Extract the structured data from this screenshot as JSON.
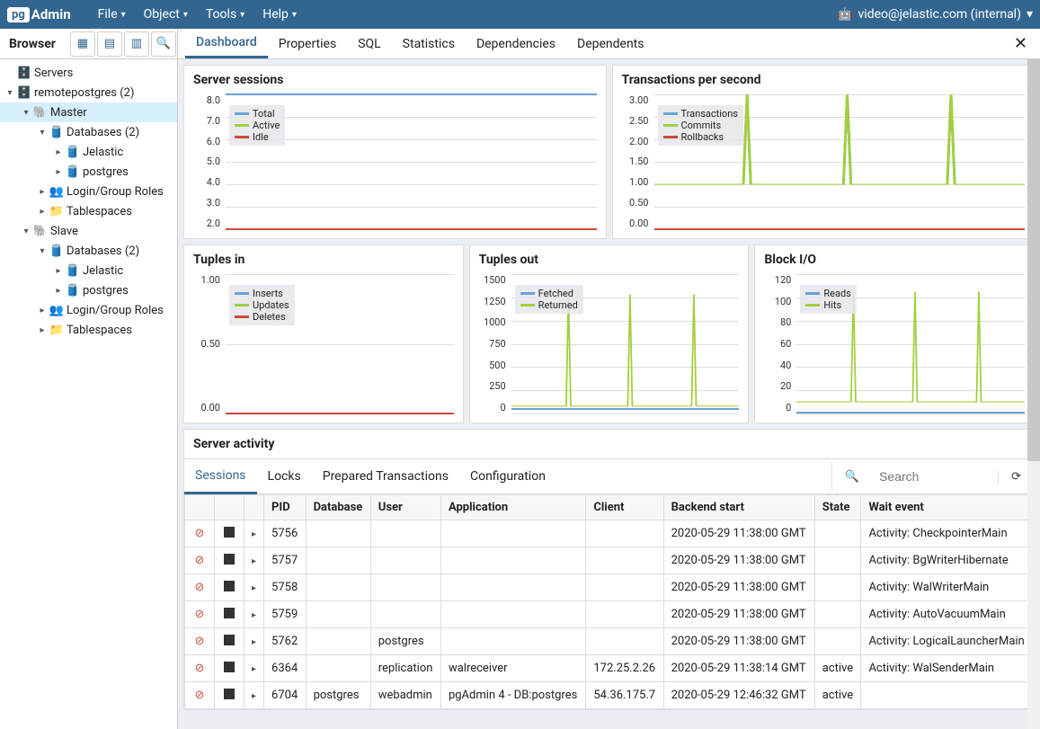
{
  "app": {
    "name_prefix": "pg",
    "name_suffix": "Admin"
  },
  "menu": {
    "file": "File",
    "object": "Object",
    "tools": "Tools",
    "help": "Help"
  },
  "user": {
    "email": "video@jelastic.com (internal)"
  },
  "browser": {
    "label": "Browser"
  },
  "tree": {
    "servers": "Servers",
    "remote": "remotepostgres (2)",
    "master": "Master",
    "databases": "Databases (2)",
    "jelastic": "Jelastic",
    "postgres": "postgres",
    "login_roles": "Login/Group Roles",
    "tablespaces": "Tablespaces",
    "slave": "Slave"
  },
  "tabs": {
    "dashboard": "Dashboard",
    "properties": "Properties",
    "sql": "SQL",
    "statistics": "Statistics",
    "dependencies": "Dependencies",
    "dependents": "Dependents"
  },
  "charts": {
    "sessions": {
      "title": "Server sessions",
      "legend": {
        "total": "Total",
        "active": "Active",
        "idle": "Idle"
      },
      "ylabels": [
        "8.0",
        "7.0",
        "6.0",
        "5.0",
        "4.0",
        "3.0",
        "2.0"
      ]
    },
    "tps": {
      "title": "Transactions per second",
      "legend": {
        "transactions": "Transactions",
        "commits": "Commits",
        "rollbacks": "Rollbacks"
      },
      "ylabels": [
        "3.00",
        "2.50",
        "2.00",
        "1.50",
        "1.00",
        "0.50",
        "0.00"
      ]
    },
    "tuples_in": {
      "title": "Tuples in",
      "legend": {
        "inserts": "Inserts",
        "updates": "Updates",
        "deletes": "Deletes"
      },
      "ylabels": [
        "1.00",
        "0.50",
        "0.00"
      ]
    },
    "tuples_out": {
      "title": "Tuples out",
      "legend": {
        "fetched": "Fetched",
        "returned": "Returned"
      },
      "ylabels": [
        "1500",
        "1250",
        "1000",
        "750",
        "500",
        "250",
        "0"
      ]
    },
    "block_io": {
      "title": "Block I/O",
      "legend": {
        "reads": "Reads",
        "hits": "Hits"
      },
      "ylabels": [
        "120",
        "100",
        "80",
        "60",
        "40",
        "20",
        "0"
      ]
    }
  },
  "chart_data": [
    {
      "id": "sessions",
      "type": "line",
      "title": "Server sessions",
      "series": [
        {
          "name": "Total",
          "color": "#6aa1d8",
          "trend": "flat",
          "value": 8.0
        },
        {
          "name": "Active",
          "color": "#a3cf3d",
          "trend": "flat",
          "value": 2.0
        },
        {
          "name": "Idle",
          "color": "#c94a3b",
          "trend": "flat",
          "value": 2.0
        }
      ],
      "ylim": [
        2.0,
        8.0
      ]
    },
    {
      "id": "tps",
      "type": "line",
      "title": "Transactions per second",
      "series": [
        {
          "name": "Transactions",
          "color": "#6aa1d8",
          "trend": "spikes",
          "baseline": 1.0,
          "peak": 3.0,
          "spike_count": 3
        },
        {
          "name": "Commits",
          "color": "#a3cf3d",
          "trend": "spikes",
          "baseline": 1.0,
          "peak": 3.0,
          "spike_count": 3
        },
        {
          "name": "Rollbacks",
          "color": "#c94a3b",
          "trend": "flat",
          "value": 0.0
        }
      ],
      "ylim": [
        0.0,
        3.0
      ]
    },
    {
      "id": "tuples_in",
      "type": "line",
      "title": "Tuples in",
      "series": [
        {
          "name": "Inserts",
          "color": "#6aa1d8",
          "trend": "flat",
          "value": 0.0
        },
        {
          "name": "Updates",
          "color": "#a3cf3d",
          "trend": "flat",
          "value": 0.0
        },
        {
          "name": "Deletes",
          "color": "#c94a3b",
          "trend": "flat",
          "value": 0.0
        }
      ],
      "ylim": [
        0.0,
        1.0
      ]
    },
    {
      "id": "tuples_out",
      "type": "line",
      "title": "Tuples out",
      "series": [
        {
          "name": "Fetched",
          "color": "#6aa1d8",
          "trend": "flat",
          "value": 50
        },
        {
          "name": "Returned",
          "color": "#a3cf3d",
          "trend": "spikes",
          "baseline": 80,
          "peak": 1280,
          "spike_count": 3
        }
      ],
      "ylim": [
        0,
        1500
      ]
    },
    {
      "id": "block_io",
      "type": "line",
      "title": "Block I/O",
      "series": [
        {
          "name": "Reads",
          "color": "#6aa1d8",
          "trend": "flat",
          "value": 1
        },
        {
          "name": "Hits",
          "color": "#a3cf3d",
          "trend": "spikes",
          "baseline": 10,
          "peak": 105,
          "spike_count": 3
        }
      ],
      "ylim": [
        0,
        120
      ]
    }
  ],
  "activity": {
    "title": "Server activity",
    "tabs": {
      "sessions": "Sessions",
      "locks": "Locks",
      "prepared": "Prepared Transactions",
      "config": "Configuration"
    },
    "search_placeholder": "Search",
    "columns": {
      "pid": "PID",
      "database": "Database",
      "user": "User",
      "application": "Application",
      "client": "Client",
      "backend_start": "Backend start",
      "state": "State",
      "wait_event": "Wait event"
    },
    "rows": [
      {
        "pid": "5756",
        "database": "",
        "user": "",
        "application": "",
        "client": "",
        "backend_start": "2020-05-29 11:38:00 GMT",
        "state": "",
        "wait_event": "Activity: CheckpointerMain"
      },
      {
        "pid": "5757",
        "database": "",
        "user": "",
        "application": "",
        "client": "",
        "backend_start": "2020-05-29 11:38:00 GMT",
        "state": "",
        "wait_event": "Activity: BgWriterHibernate"
      },
      {
        "pid": "5758",
        "database": "",
        "user": "",
        "application": "",
        "client": "",
        "backend_start": "2020-05-29 11:38:00 GMT",
        "state": "",
        "wait_event": "Activity: WalWriterMain"
      },
      {
        "pid": "5759",
        "database": "",
        "user": "",
        "application": "",
        "client": "",
        "backend_start": "2020-05-29 11:38:00 GMT",
        "state": "",
        "wait_event": "Activity: AutoVacuumMain"
      },
      {
        "pid": "5762",
        "database": "",
        "user": "postgres",
        "application": "",
        "client": "",
        "backend_start": "2020-05-29 11:38:00 GMT",
        "state": "",
        "wait_event": "Activity: LogicalLauncherMain"
      },
      {
        "pid": "6364",
        "database": "",
        "user": "replication",
        "application": "walreceiver",
        "client": "172.25.2.26",
        "backend_start": "2020-05-29 11:38:14 GMT",
        "state": "active",
        "wait_event": "Activity: WalSenderMain"
      },
      {
        "pid": "6704",
        "database": "postgres",
        "user": "webadmin",
        "application": "pgAdmin 4 - DB:postgres",
        "client": "54.36.175.7",
        "backend_start": "2020-05-29 12:46:32 GMT",
        "state": "active",
        "wait_event": ""
      }
    ]
  },
  "colors": {
    "blue": "#6aa1d8",
    "green": "#a3cf3d",
    "red": "#c94a3b",
    "brand": "#326690"
  }
}
